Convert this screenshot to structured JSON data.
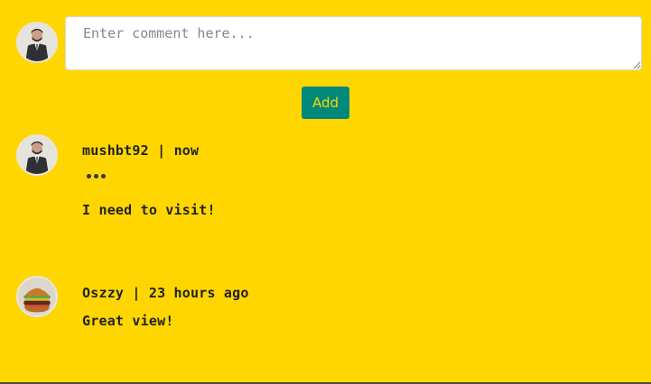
{
  "composer": {
    "placeholder": "Enter comment here...",
    "value": "",
    "add_label": "Add",
    "avatar": "user-avatar-man-suit"
  },
  "comments": [
    {
      "author": "mushbt92",
      "separator": " | ",
      "time": "now",
      "text": "I need to visit!",
      "avatar": "user-avatar-man-suit",
      "more_icon": "more-horizontal-icon"
    },
    {
      "author": "Oszzy",
      "separator": " | ",
      "time": "23 hours ago",
      "text": "Great view!",
      "avatar": "user-avatar-burger"
    }
  ],
  "colors": {
    "background": "#FFD600",
    "button_bg": "#00897B",
    "button_text": "#FFD600",
    "text": "#222222"
  }
}
